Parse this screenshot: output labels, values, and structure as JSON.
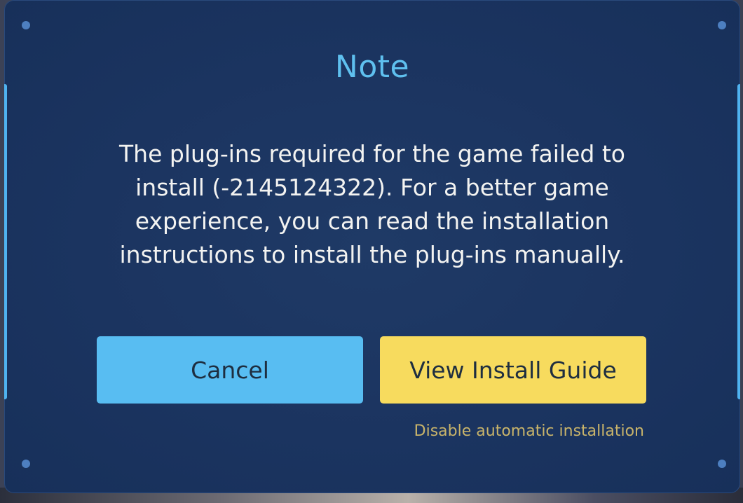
{
  "dialog": {
    "title": "Note",
    "message": "The plug-ins required for the game failed to install (-2145124322). For a better game experience, you can read the installation instructions to install the plug-ins manually.",
    "cancel_label": "Cancel",
    "guide_label": "View Install Guide",
    "disable_label": "Disable automatic installation"
  },
  "colors": {
    "dialog_background": "#1b3460",
    "title": "#5fc0ef",
    "cancel_button": "#58bdf2",
    "guide_button": "#f7db5e",
    "disable_link": "#c9b46a"
  }
}
